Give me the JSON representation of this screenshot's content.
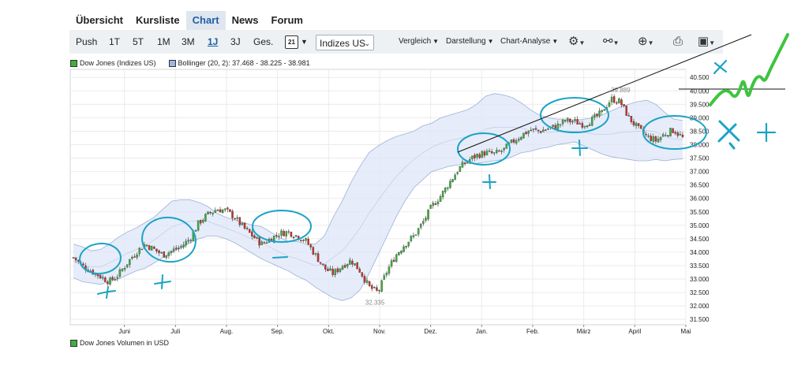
{
  "nav": {
    "tabs": [
      {
        "label": "Übersicht",
        "active": false
      },
      {
        "label": "Kursliste",
        "active": false
      },
      {
        "label": "Chart",
        "active": true
      },
      {
        "label": "News",
        "active": false
      },
      {
        "label": "Forum",
        "active": false
      }
    ]
  },
  "toolbar": {
    "push_label": "Push",
    "ranges": [
      {
        "label": "1T",
        "selected": false
      },
      {
        "label": "5T",
        "selected": false
      },
      {
        "label": "1M",
        "selected": false
      },
      {
        "label": "3M",
        "selected": false
      },
      {
        "label": "1J",
        "selected": true
      },
      {
        "label": "3J",
        "selected": false
      },
      {
        "label": "Ges.",
        "selected": false
      }
    ],
    "calendar_day": "21",
    "index_select": "Indizes US",
    "menus": [
      "Vergleich",
      "Darstellung",
      "Chart-Analyse"
    ],
    "icons": [
      "settings-icon",
      "network-icon",
      "zoom-icon",
      "print-icon",
      "save-icon"
    ]
  },
  "legend": {
    "series1": "Dow Jones (Indizes US)",
    "series2": "Bollinger (20, 2): 37.468 - 38.225 - 38.981",
    "volume": "Dow Jones Volumen in USD"
  },
  "colors": {
    "up": "#3fae3f",
    "down": "#c8322c",
    "bollinger_fill": "#dde6f7",
    "bollinger_line": "#9cb1d8",
    "annot_cyan": "#1aa3c6",
    "annot_green": "#3ec43e",
    "legend_green": "#3fae3f",
    "legend_blue": "#9fb4e0"
  },
  "chart_data": {
    "type": "candlestick",
    "x_labels": [
      "Juni",
      "Juli",
      "Aug.",
      "Sep.",
      "Okt.",
      "Nov.",
      "Dez.",
      "Jan.",
      "Feb.",
      "März",
      "April",
      "Mai"
    ],
    "y_ticks": [
      "31.500",
      "32.000",
      "32.500",
      "33.000",
      "33.500",
      "34.000",
      "34.500",
      "35.000",
      "35.500",
      "36.000",
      "36.500",
      "37.000",
      "37.500",
      "38.000",
      "38.500",
      "39.000",
      "39.500",
      "40.000",
      "40.500"
    ],
    "ylim": [
      31300,
      40800
    ],
    "annotations": [
      {
        "text": "39.889",
        "x": 0.894,
        "y": 39889
      },
      {
        "text": "32.335",
        "x": 0.495,
        "y": 32335
      }
    ],
    "close_series": [
      33800,
      33500,
      33300,
      33100,
      32900,
      33150,
      33600,
      34000,
      34300,
      34100,
      33900,
      34050,
      34200,
      34500,
      35100,
      35400,
      35600,
      35550,
      35300,
      34900,
      34600,
      34300,
      34500,
      34700,
      34750,
      34600,
      34400,
      33900,
      33400,
      33200,
      33500,
      33700,
      33300,
      32700,
      32500,
      33300,
      33900,
      34300,
      34600,
      35100,
      35700,
      36100,
      36600,
      37100,
      37400,
      37600,
      37700,
      37650,
      37800,
      38100,
      38350,
      38550,
      38500,
      38600,
      38700,
      38900,
      38850,
      38750,
      38950,
      39200,
      39700,
      39600,
      39000,
      38600,
      38300,
      38150,
      38400,
      38550,
      38250
    ],
    "bollinger_upper": [
      34300,
      34200,
      34050,
      34100,
      34300,
      34550,
      34750,
      34900,
      35100,
      35300,
      35600,
      35900,
      35950,
      35950,
      35850,
      35700,
      35450,
      35300,
      35200,
      35100,
      35000,
      34950,
      34750,
      34550,
      34400,
      34400,
      34300,
      34300,
      34600,
      35300,
      35900,
      36600,
      37200,
      37700,
      37950,
      38150,
      38300,
      38400,
      38500,
      38700,
      38800,
      39000,
      39100,
      39200,
      39300,
      39500,
      39800,
      39900,
      39850,
      39750,
      39550,
      39300,
      39100,
      39000,
      38950,
      38950,
      38900,
      38950,
      39000,
      39100,
      39250,
      39400,
      39500,
      39600,
      39650,
      39500,
      39200,
      38950,
      38900
    ],
    "bollinger_lower": [
      33050,
      32900,
      32850,
      32800,
      32900,
      33000,
      33150,
      33300,
      33400,
      33600,
      33800,
      34000,
      34150,
      34350,
      34500,
      34600,
      34600,
      34500,
      34350,
      34150,
      33950,
      33750,
      33600,
      33450,
      33300,
      33100,
      32950,
      32700,
      32500,
      32300,
      32200,
      32300,
      32600,
      33200,
      33900,
      34600,
      35300,
      35900,
      36400,
      36700,
      37000,
      37100,
      37200,
      37250,
      37300,
      37300,
      37350,
      37400,
      37450,
      37550,
      37700,
      37750,
      37850,
      37900,
      38000,
      38050,
      38100,
      37950,
      37800,
      37650,
      37550,
      37500,
      37450,
      37400,
      37400,
      37450,
      37400,
      37450,
      37470
    ]
  }
}
